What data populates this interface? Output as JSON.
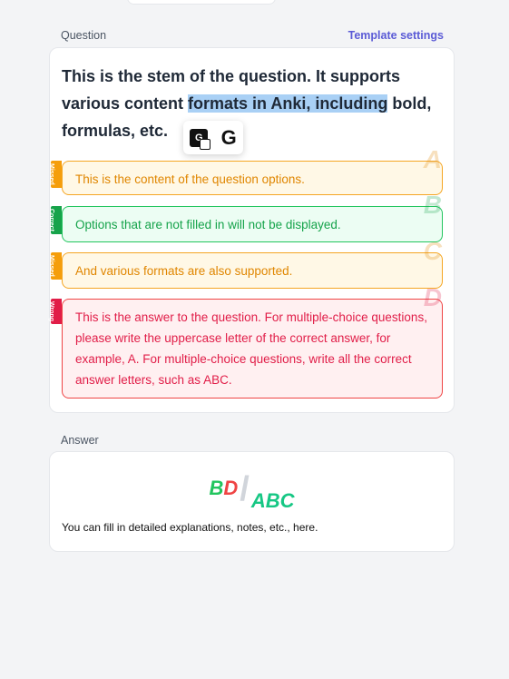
{
  "question_section": {
    "label": "Question",
    "settings_link": "Template settings"
  },
  "stem": {
    "before": "This is the stem of the question. It supports various content ",
    "highlighted": "formats in Anki, including",
    "after": " bold, formulas, etc."
  },
  "popup": {
    "icons": [
      "google-translate-icon",
      "google-g-icon"
    ],
    "translate_glyph": "G",
    "google_glyph": "G"
  },
  "options": [
    {
      "status": "Missed",
      "letter": "A",
      "text": "This is the content of the question options."
    },
    {
      "status": "Correct",
      "letter": "B",
      "text": "Options that are not filled in will not be displayed."
    },
    {
      "status": "Missed",
      "letter": "C",
      "text": "And various formats are also supported."
    },
    {
      "status": "Wrong",
      "letter": "D",
      "text": "This is the answer to the question. For multiple-choice questions, please write the uppercase letter of the correct answer, for example, A. For multiple-choice questions, write all the correct answer letters, such as ABC."
    }
  ],
  "answer_section": {
    "label": "Answer",
    "user_answer_correct": "B",
    "user_answer_wrong": "D",
    "separator": "/",
    "correct_answer": "ABC",
    "explanation": "You can fill in detailed explanations, notes, etc., here."
  },
  "colors": {
    "missed": "#f59e0b",
    "correct": "#22c55e",
    "wrong": "#ef4444",
    "link": "#5b5bd6",
    "highlight": "#a9d0f5"
  }
}
